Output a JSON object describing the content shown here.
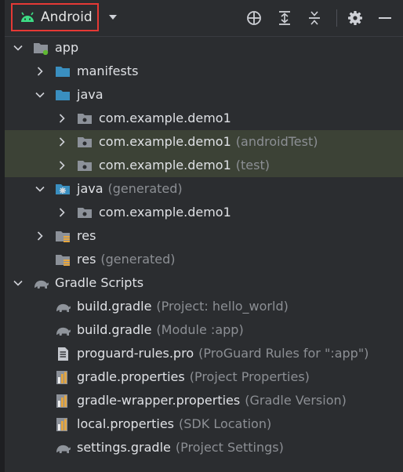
{
  "toolbar": {
    "view_mode": "Android",
    "icons": [
      "locate-icon",
      "expand-all-icon",
      "collapse-all-icon",
      "gear-icon",
      "minimize-icon"
    ]
  },
  "tree": [
    {
      "label": "app",
      "hint": "",
      "depth": 0,
      "expand": "open",
      "icon": "module-folder-icon"
    },
    {
      "label": "manifests",
      "hint": "",
      "depth": 1,
      "expand": "closed",
      "icon": "folder-icon"
    },
    {
      "label": "java",
      "hint": "",
      "depth": 1,
      "expand": "open",
      "icon": "folder-icon"
    },
    {
      "label": "com.example.demo1",
      "hint": "",
      "depth": 2,
      "expand": "closed",
      "icon": "package-icon"
    },
    {
      "label": "com.example.demo1",
      "hint": "(androidTest)",
      "depth": 2,
      "expand": "closed",
      "icon": "package-icon",
      "selected": true
    },
    {
      "label": "com.example.demo1",
      "hint": "(test)",
      "depth": 2,
      "expand": "closed",
      "icon": "package-icon",
      "selected": true
    },
    {
      "label": "java",
      "hint": "(generated)",
      "depth": 1,
      "expand": "open",
      "icon": "generated-folder-icon"
    },
    {
      "label": "com.example.demo1",
      "hint": "",
      "depth": 2,
      "expand": "closed",
      "icon": "package-icon"
    },
    {
      "label": "res",
      "hint": "",
      "depth": 1,
      "expand": "closed",
      "icon": "res-folder-icon"
    },
    {
      "label": "res",
      "hint": "(generated)",
      "depth": 1,
      "expand": "none",
      "icon": "res-folder-icon"
    },
    {
      "label": "Gradle Scripts",
      "hint": "",
      "depth": 0,
      "expand": "open",
      "icon": "gradle-elephant-icon"
    },
    {
      "label": "build.gradle",
      "hint": "(Project: hello_world)",
      "depth": 1,
      "expand": "none",
      "icon": "gradle-elephant-icon"
    },
    {
      "label": "build.gradle",
      "hint": "(Module :app)",
      "depth": 1,
      "expand": "none",
      "icon": "gradle-elephant-icon"
    },
    {
      "label": "proguard-rules.pro",
      "hint": "(ProGuard Rules for \":app\")",
      "depth": 1,
      "expand": "none",
      "icon": "text-file-icon"
    },
    {
      "label": "gradle.properties",
      "hint": "(Project Properties)",
      "depth": 1,
      "expand": "none",
      "icon": "properties-file-icon"
    },
    {
      "label": "gradle-wrapper.properties",
      "hint": "(Gradle Version)",
      "depth": 1,
      "expand": "none",
      "icon": "properties-file-icon"
    },
    {
      "label": "local.properties",
      "hint": "(SDK Location)",
      "depth": 1,
      "expand": "none",
      "icon": "properties-file-icon"
    },
    {
      "label": "settings.gradle",
      "hint": "(Project Settings)",
      "depth": 1,
      "expand": "none",
      "icon": "gradle-elephant-icon"
    }
  ]
}
